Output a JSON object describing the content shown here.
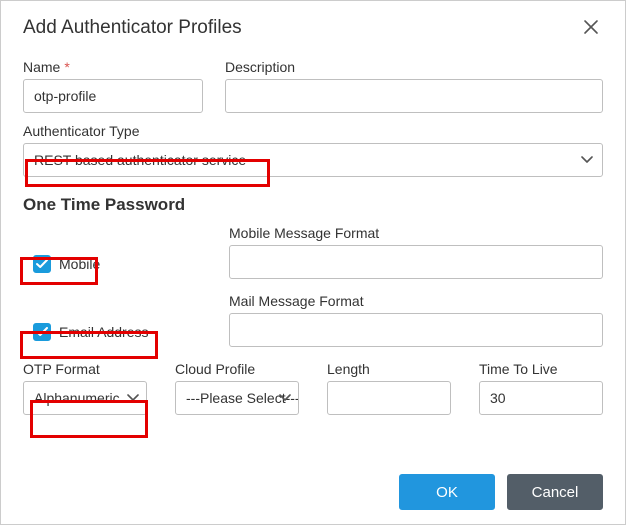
{
  "dialog": {
    "title": "Add Authenticator Profiles",
    "fields": {
      "name_label": "Name",
      "name_value": "otp-profile",
      "desc_label": "Description",
      "desc_value": "",
      "authtype_label": "Authenticator Type",
      "authtype_value": "REST based authenticator service"
    },
    "section_heading": "One Time Password",
    "otp": {
      "mobile_checked": true,
      "mobile_label": "Mobile",
      "mobile_msg_label": "Mobile Message Format",
      "mobile_msg_value": "",
      "email_checked": true,
      "email_label": "Email Address",
      "mail_msg_label": "Mail Message Format",
      "mail_msg_value": "",
      "format_label": "OTP Format",
      "format_value": "Alphanumeric",
      "cloud_label": "Cloud Profile",
      "cloud_value": "---Please Select---",
      "length_label": "Length",
      "length_value": "",
      "ttl_label": "Time To Live",
      "ttl_value": "30"
    },
    "buttons": {
      "ok": "OK",
      "cancel": "Cancel"
    }
  }
}
